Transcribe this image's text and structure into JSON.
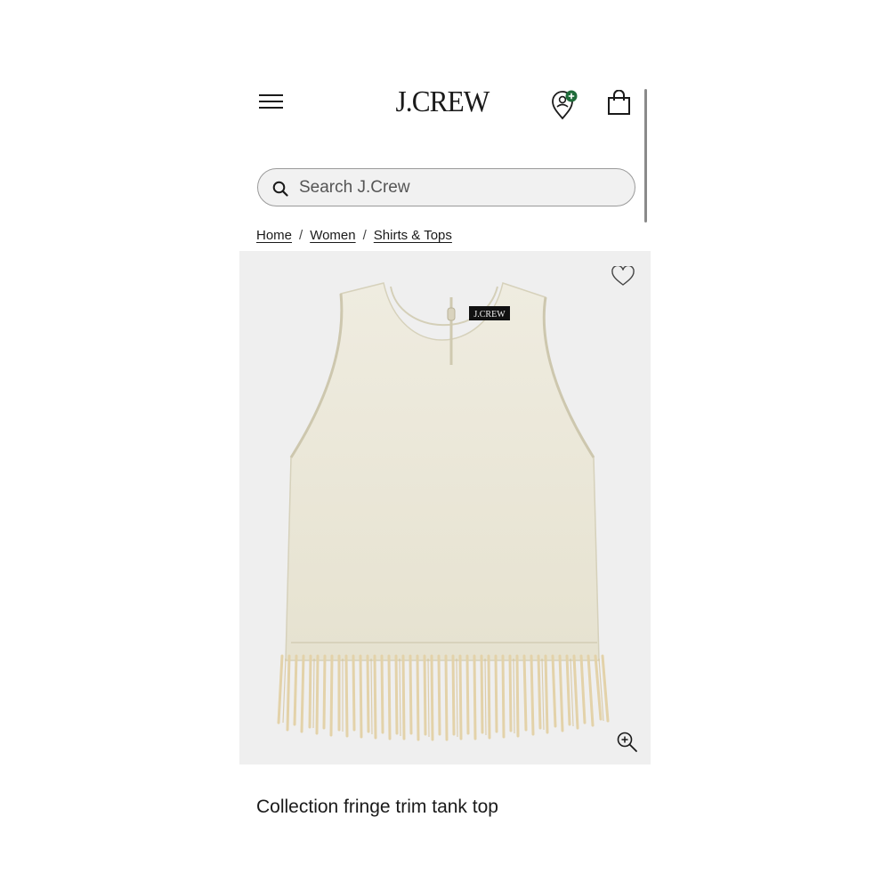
{
  "header": {
    "logo": "J.CREW",
    "menu_icon": "hamburger-menu-icon",
    "store_icon": "location-pin-plus-icon",
    "bag_icon": "shopping-bag-icon"
  },
  "search": {
    "placeholder": "Search J.Crew",
    "value": ""
  },
  "breadcrumb": {
    "items": [
      {
        "label": "Home"
      },
      {
        "label": "Women"
      },
      {
        "label": "Shirts & Tops"
      }
    ],
    "separator": "/"
  },
  "product": {
    "title": "Collection fringe trim tank top",
    "label_tag": "J.CREW",
    "image_bg": "#efefef",
    "fabric_color": "#ebe7d6",
    "fringe_color": "#e8d9b5"
  },
  "colors": {
    "text": "#1a1a1a",
    "badge_green": "#1f6b3a"
  }
}
